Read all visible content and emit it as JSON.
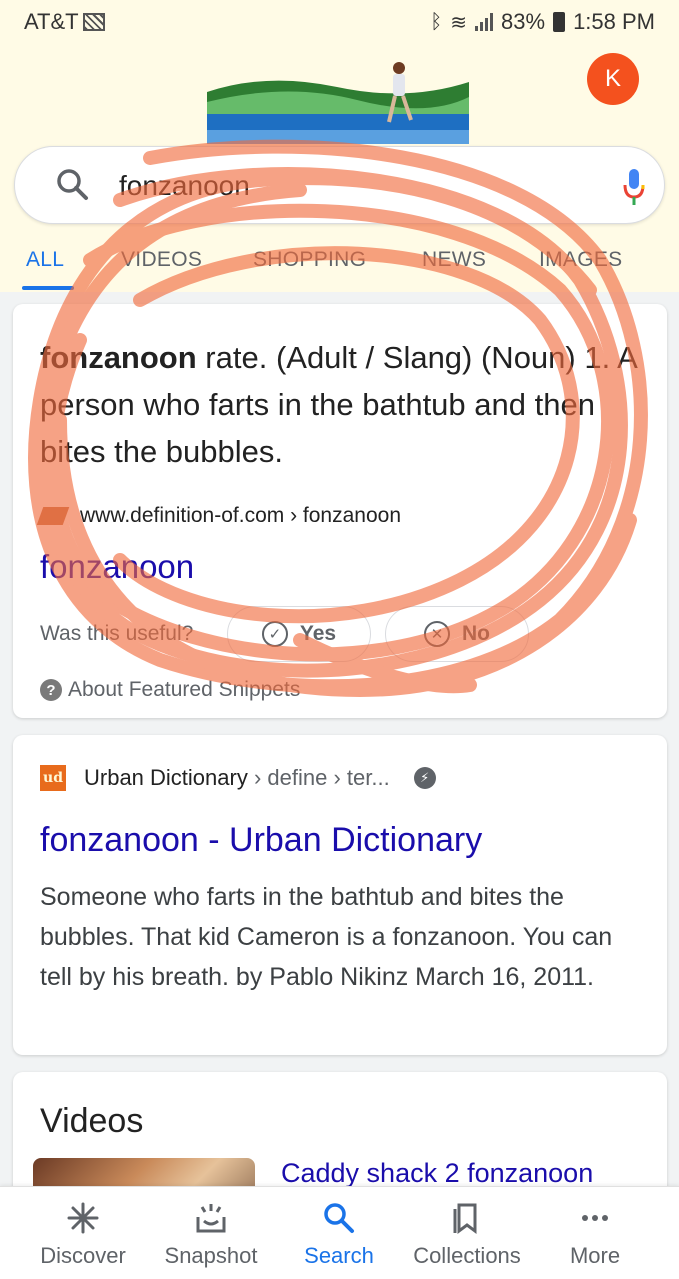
{
  "status_bar": {
    "carrier": "AT&T",
    "battery": "83%",
    "time": "1:58 PM"
  },
  "header": {
    "avatar_letter": "K",
    "search_query": "fonzanoon"
  },
  "tabs": [
    "ALL",
    "VIDEOS",
    "SHOPPING",
    "NEWS",
    "IMAGES"
  ],
  "featured_snippet": {
    "term": "fonzanoon",
    "definition": " rate. (Adult / Slang) (Noun) 1. A person who farts in the bathtub and then bites the bubbles.",
    "source_url": "www.definition-of.com › fonzanoon",
    "link_title": "fonzanoon",
    "feedback_question": "Was this useful?",
    "yes_label": "Yes",
    "no_label": "No",
    "about_label": "About Featured Snippets"
  },
  "urban_result": {
    "icon_text": "ud",
    "site": "Urban Dictionary",
    "breadcrumb": " › define › ter...",
    "title": "fonzanoon - Urban Dictionary",
    "description": "Someone who farts in the bathtub and bites the bubbles. That kid Cameron is a fonzanoon. You can tell by his breath. by Pablo Nikinz March 16, 2011."
  },
  "videos": {
    "heading": "Videos",
    "first_title": "Caddy shack 2 fonzanoon"
  },
  "bottom_nav": [
    "Discover",
    "Snapshot",
    "Search",
    "Collections",
    "More"
  ],
  "colors": {
    "accent": "#1a73e8",
    "link": "#1a0dab",
    "avatar": "#f4511e",
    "scribble": "#f26a3c"
  }
}
